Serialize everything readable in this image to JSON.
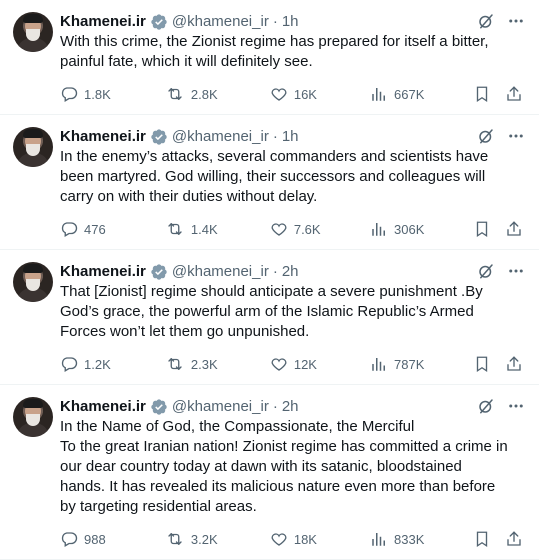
{
  "tweets": [
    {
      "name": "Khamenei.ir",
      "handle": "@khamenei_ir",
      "dot": "·",
      "time": "1h",
      "text": "With this crime, the Zionist regime has prepared for itself a bitter, painful fate, which it will definitely see.",
      "replies": "1.8K",
      "retweets": "2.8K",
      "likes": "16K",
      "views": "667K"
    },
    {
      "name": "Khamenei.ir",
      "handle": "@khamenei_ir",
      "dot": "·",
      "time": "1h",
      "text": "In the enemy’s attacks, several commanders and scientists have been martyred. God willing, their successors and colleagues will carry on with their duties without delay.",
      "replies": "476",
      "retweets": "1.4K",
      "likes": "7.6K",
      "views": "306K"
    },
    {
      "name": "Khamenei.ir",
      "handle": "@khamenei_ir",
      "dot": "·",
      "time": "2h",
      "text": "That [Zionist] regime should anticipate a severe punishment .By God’s grace, the powerful arm of the Islamic Republic’s Armed Forces won’t let them go unpunished.",
      "replies": "1.2K",
      "retweets": "2.3K",
      "likes": "12K",
      "views": "787K"
    },
    {
      "name": "Khamenei.ir",
      "handle": "@khamenei_ir",
      "dot": "·",
      "time": "2h",
      "text": "In the Name of God, the Compassionate, the Merciful\nTo the great Iranian nation! Zionist regime has committed a crime in our dear country today at dawn with its satanic, bloodstained hands. It has revealed its malicious nature even more than before by targeting residential areas.",
      "replies": "988",
      "retweets": "3.2K",
      "likes": "18K",
      "views": "833K"
    }
  ],
  "icons": {
    "verified": "verified-badge-icon",
    "grok": "grok-icon",
    "more": "more-icon",
    "reply": "reply-icon",
    "retweet": "retweet-icon",
    "like": "heart-icon",
    "views": "views-icon",
    "bookmark": "bookmark-icon",
    "share": "share-icon"
  },
  "colors": {
    "text": "#0f1419",
    "muted": "#536471",
    "verified": "#829aab",
    "divider": "#eff3f4"
  }
}
